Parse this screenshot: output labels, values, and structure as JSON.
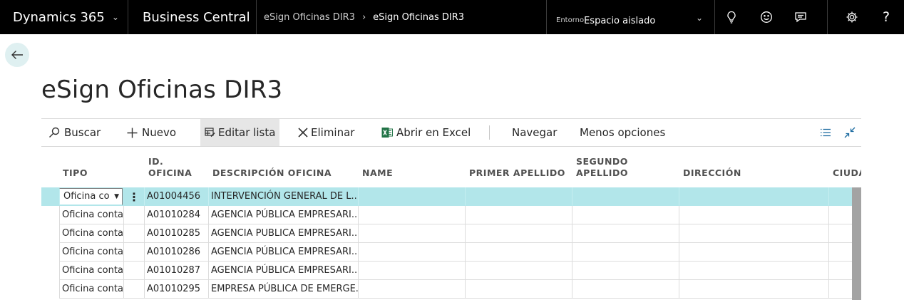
{
  "topbar": {
    "product": "Dynamics 365",
    "app": "Business Central",
    "breadcrumb": [
      "eSign Oficinas DIR3",
      "eSign Oficinas DIR3"
    ],
    "env_label": "Entorno",
    "env_value": "Espacio aislado",
    "icons": [
      "lightbulb-icon",
      "smiley-icon",
      "chat-icon",
      "gear-icon",
      "help-icon"
    ]
  },
  "page": {
    "title": "eSign Oficinas DIR3"
  },
  "actions": {
    "search": "Buscar",
    "new": "Nuevo",
    "edit_list": "Editar lista",
    "delete": "Eliminar",
    "excel": "Abrir en Excel",
    "navigate": "Navegar",
    "less": "Menos opciones"
  },
  "grid": {
    "columns": {
      "tipo": "TIPO",
      "id1": "ID.",
      "id2": "OFICINA",
      "desc": "DESCRIPCIÓN OFICINA",
      "name": "NAME",
      "primer": "PRIMER APELLIDO",
      "segundo1": "SEGUNDO",
      "segundo2": "APELLIDO",
      "direccion": "DIRECCIÓN",
      "ciudad": "CIUDA"
    },
    "rows": [
      {
        "tipo": "Oficina co",
        "id": "A01004456",
        "desc": "INTERVENCIÓN GENERAL DE L..."
      },
      {
        "tipo": "Oficina contal",
        "id": "A01010284",
        "desc": "AGENCIA PÚBLICA EMPRESARI..."
      },
      {
        "tipo": "Oficina contal",
        "id": "A01010285",
        "desc": "AGENCIA PUBLICA EMPRESARI..."
      },
      {
        "tipo": "Oficina contal",
        "id": "A01010286",
        "desc": "AGENCIA PÚBLICA EMPRESARI..."
      },
      {
        "tipo": "Oficina contal",
        "id": "A01010287",
        "desc": "AGENCIA PÚBLICA EMPRESARI..."
      },
      {
        "tipo": "Oficina contal",
        "id": "A01010295",
        "desc": "EMPRESA PÚBLICA DE EMERGE..."
      }
    ]
  },
  "colors": {
    "topbar_bg": "#000000",
    "selected_row": "#b2e6ea",
    "accent": "#00838f",
    "excel_green": "#217346"
  }
}
